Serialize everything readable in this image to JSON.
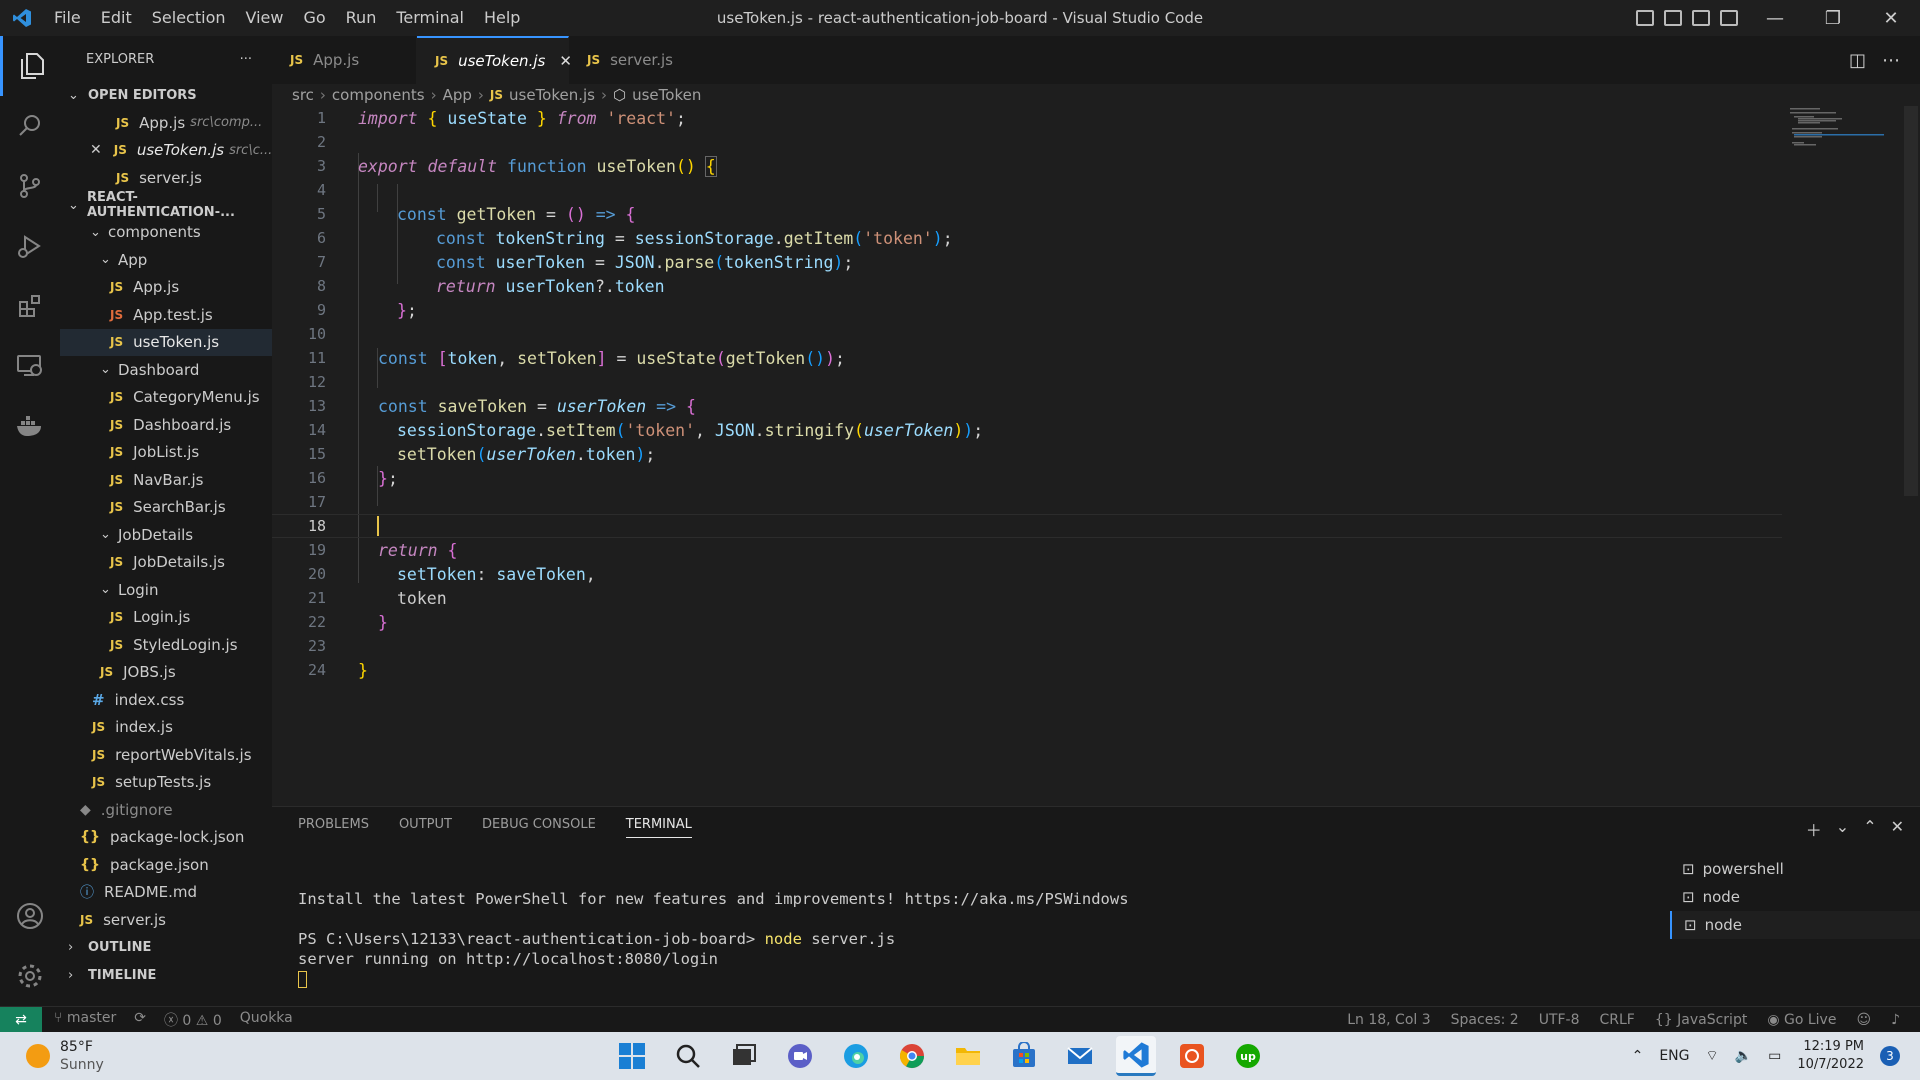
{
  "window": {
    "title": "useToken.js - react-authentication-job-board - Visual Studio Code",
    "menu": [
      "File",
      "Edit",
      "Selection",
      "View",
      "Go",
      "Run",
      "Terminal",
      "Help"
    ]
  },
  "sidebar": {
    "header": "EXPLORER",
    "more": "···",
    "open_editors_label": "OPEN EDITORS",
    "open_editors": [
      {
        "name": "App.js",
        "path": "src\\comp..."
      },
      {
        "name": "useToken.js",
        "path": "src\\c..."
      },
      {
        "name": "server.js",
        "path": ""
      }
    ],
    "project_label": "REACT-AUTHENTICATION-...",
    "tree": {
      "components": "components",
      "app_folder": "App",
      "app_js": "App.js",
      "app_test": "App.test.js",
      "usetoken": "useToken.js",
      "dashboard_folder": "Dashboard",
      "category": "CategoryMenu.js",
      "dashboard_js": "Dashboard.js",
      "joblist": "JobList.js",
      "navbar": "NavBar.js",
      "searchbar": "SearchBar.js",
      "jobdetails_folder": "JobDetails",
      "jobdetails_js": "JobDetails.js",
      "login_folder": "Login",
      "login_js": "Login.js",
      "styledlogin": "StyledLogin.js",
      "jobs": "JOBS.js",
      "index_css": "index.css",
      "index_js": "index.js",
      "reportweb": "reportWebVitals.js",
      "setuptests": "setupTests.js",
      "gitignore": ".gitignore",
      "pkglock": "package-lock.json",
      "pkg": "package.json",
      "readme": "README.md",
      "server": "server.js"
    },
    "outline_label": "OUTLINE",
    "timeline_label": "TIMELINE"
  },
  "tabs": [
    {
      "label": "App.js"
    },
    {
      "label": "useToken.js"
    },
    {
      "label": "server.js"
    }
  ],
  "breadcrumb": [
    "src",
    "components",
    "App",
    "useToken.js",
    "useToken"
  ],
  "editor": {
    "line_numbers": [
      "1",
      "2",
      "3",
      "4",
      "5",
      "6",
      "7",
      "8",
      "9",
      "10",
      "11",
      "12",
      "13",
      "14",
      "15",
      "16",
      "17",
      "18",
      "19",
      "20",
      "21",
      "22",
      "23",
      "24"
    ],
    "t": {
      "import": "import",
      "useState": "useState",
      "from": "from",
      "react": "'react'",
      "export": "export",
      "default": "default",
      "function": "function",
      "useToken": "useToken",
      "const": "const",
      "getToken": "getToken",
      "tokenString": "tokenString",
      "sessionStorage": "sessionStorage",
      "getItem": "getItem",
      "tokenStr": "'token'",
      "userToken": "userToken",
      "JSON": "JSON",
      "parse": "parse",
      "return": "return",
      "token": "token",
      "setToken": "setToken",
      "saveToken": "saveToken",
      "setItem": "setItem",
      "stringify": "stringify"
    }
  },
  "panel": {
    "tabs": [
      "PROBLEMS",
      "OUTPUT",
      "DEBUG CONSOLE",
      "TERMINAL"
    ],
    "terminal_lines": {
      "l1": "Install the latest PowerShell for new features and improvements! https://aka.ms/PSWindows",
      "prompt": "PS C:\\Users\\12133\\react-authentication-job-board> ",
      "cmd": "node",
      "arg": " server.js",
      "l3": "server running on http://localhost:8080/login"
    },
    "terminals": [
      "powershell",
      "node",
      "node"
    ]
  },
  "statusbar": {
    "branch": "master",
    "errors": "0",
    "warnings": "0",
    "quokka": "Quokka",
    "position": "Ln 18, Col 3",
    "spaces": "Spaces: 2",
    "encoding": "UTF-8",
    "eol": "CRLF",
    "language": "JavaScript",
    "golive": "Go Live"
  },
  "taskbar": {
    "temp": "85°F",
    "weather": "Sunny",
    "lang": "ENG",
    "time": "12:19 PM",
    "date": "10/7/2022",
    "notifications": "3"
  },
  "colors": {
    "accent": "#3794ff",
    "remote": "#16825d",
    "js_icon": "#e8c44a"
  }
}
